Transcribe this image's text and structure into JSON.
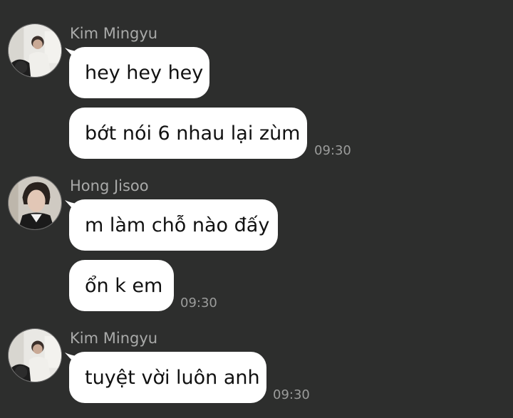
{
  "messages": [
    {
      "sender": "Kim Mingyu",
      "avatar": "avatar-kim-mingyu",
      "bubbles": [
        "hey hey hey",
        "bớt nói 6 nhau lại zùm"
      ],
      "time": "09:30"
    },
    {
      "sender": "Hong Jisoo",
      "avatar": "avatar-hong-jisoo",
      "bubbles": [
        "m làm chỗ nào đấy",
        "ổn k em"
      ],
      "time": "09:30"
    },
    {
      "sender": "Kim Mingyu",
      "avatar": "avatar-kim-mingyu",
      "bubbles": [
        "tuyệt vời luôn anh"
      ],
      "time": "09:30"
    }
  ],
  "colors": {
    "background": "#2d2e2d",
    "bubble": "#ffffff",
    "sender_text": "#a9aaa9",
    "time_text": "#9b9c9b"
  }
}
